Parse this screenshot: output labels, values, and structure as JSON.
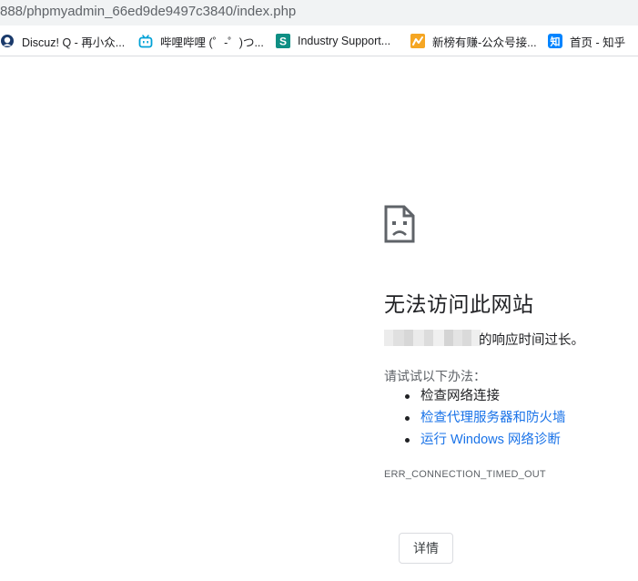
{
  "browser": {
    "address_url": "888/phpmyadmin_66ed9de9497c3840/index.php",
    "bookmarks": [
      {
        "label": "Discuz! Q - 再小众...",
        "icon": "discuz-icon"
      },
      {
        "label": "哔哩哔哩 (゜-゜)つ...",
        "icon": "bilibili-icon"
      },
      {
        "label": "Industry Support...",
        "icon": "industry-support-icon"
      },
      {
        "label": "新榜有赚-公众号接...",
        "icon": "xinbang-icon"
      },
      {
        "label": "首页 - 知乎",
        "icon": "zhihu-icon"
      }
    ]
  },
  "error_page": {
    "icon": "sad-page-icon",
    "title": "无法访问此网站",
    "summary_suffix": "的响应时间过长。",
    "suggestions_title": "请试试以下办法：",
    "suggestions": [
      {
        "label": "检查网络连接",
        "link": false
      },
      {
        "label": "检查代理服务器和防火墙",
        "link": true
      },
      {
        "label": "运行 Windows 网络诊断",
        "link": true
      }
    ],
    "error_code": "ERR_CONNECTION_TIMED_OUT",
    "details_button": "详情"
  },
  "colors": {
    "link": "#1a73e8",
    "text": "#202124",
    "secondary_text": "#5f6368",
    "address_bar_bg": "#f1f3f4"
  }
}
